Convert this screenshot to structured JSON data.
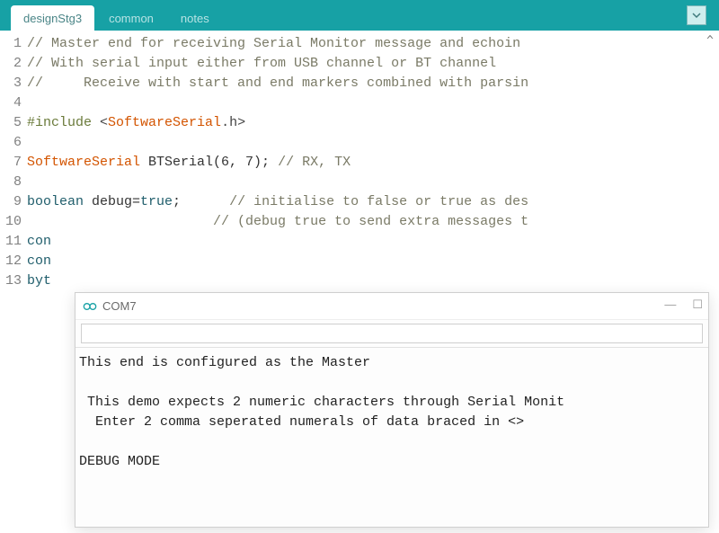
{
  "tabs": {
    "items": [
      "designStg3",
      "common",
      "notes"
    ],
    "active_index": 0
  },
  "scroll_hint": "^",
  "code": {
    "lines": [
      {
        "n": 1,
        "seg": [
          {
            "cls": "comment",
            "t": "// Master end for receiving Serial Monitor message and echoin"
          }
        ]
      },
      {
        "n": 2,
        "seg": [
          {
            "cls": "comment",
            "t": "// With serial input either from USB channel or BT channel"
          }
        ]
      },
      {
        "n": 3,
        "seg": [
          {
            "cls": "comment",
            "t": "//     Receive with start and end markers combined with parsin"
          }
        ]
      },
      {
        "n": 4,
        "seg": []
      },
      {
        "n": 5,
        "seg": [
          {
            "cls": "preproc",
            "t": "#include "
          },
          {
            "cls": "punct",
            "t": "<"
          },
          {
            "cls": "type",
            "t": "SoftwareSerial"
          },
          {
            "cls": "punct",
            "t": ".h>"
          }
        ]
      },
      {
        "n": 6,
        "seg": []
      },
      {
        "n": 7,
        "seg": [
          {
            "cls": "type",
            "t": "SoftwareSerial"
          },
          {
            "cls": "ident",
            "t": " BTSerial(6, 7); "
          },
          {
            "cls": "comment",
            "t": "// RX, TX"
          }
        ]
      },
      {
        "n": 8,
        "seg": []
      },
      {
        "n": 9,
        "seg": [
          {
            "cls": "keyword",
            "t": "boolean"
          },
          {
            "cls": "ident",
            "t": " debug="
          },
          {
            "cls": "keyword",
            "t": "true"
          },
          {
            "cls": "ident",
            "t": ";      "
          },
          {
            "cls": "comment",
            "t": "// initialise to false or true as des"
          }
        ]
      },
      {
        "n": 10,
        "seg": [
          {
            "cls": "ident",
            "t": "                       "
          },
          {
            "cls": "comment",
            "t": "// (debug true to send extra messages t"
          }
        ]
      },
      {
        "n": 11,
        "seg": [
          {
            "cls": "keyword",
            "t": "con"
          }
        ]
      },
      {
        "n": 12,
        "seg": [
          {
            "cls": "keyword",
            "t": "con"
          }
        ]
      },
      {
        "n": 13,
        "seg": [
          {
            "cls": "keyword",
            "t": "byt"
          }
        ]
      }
    ]
  },
  "serial": {
    "title": "COM7",
    "min": "—",
    "max": "☐",
    "input_value": "",
    "input_placeholder": "",
    "output": "This end is configured as the Master\n\n This demo expects 2 numeric characters through Serial Monit\n  Enter 2 comma seperated numerals of data braced in <>\n\nDEBUG MODE"
  }
}
